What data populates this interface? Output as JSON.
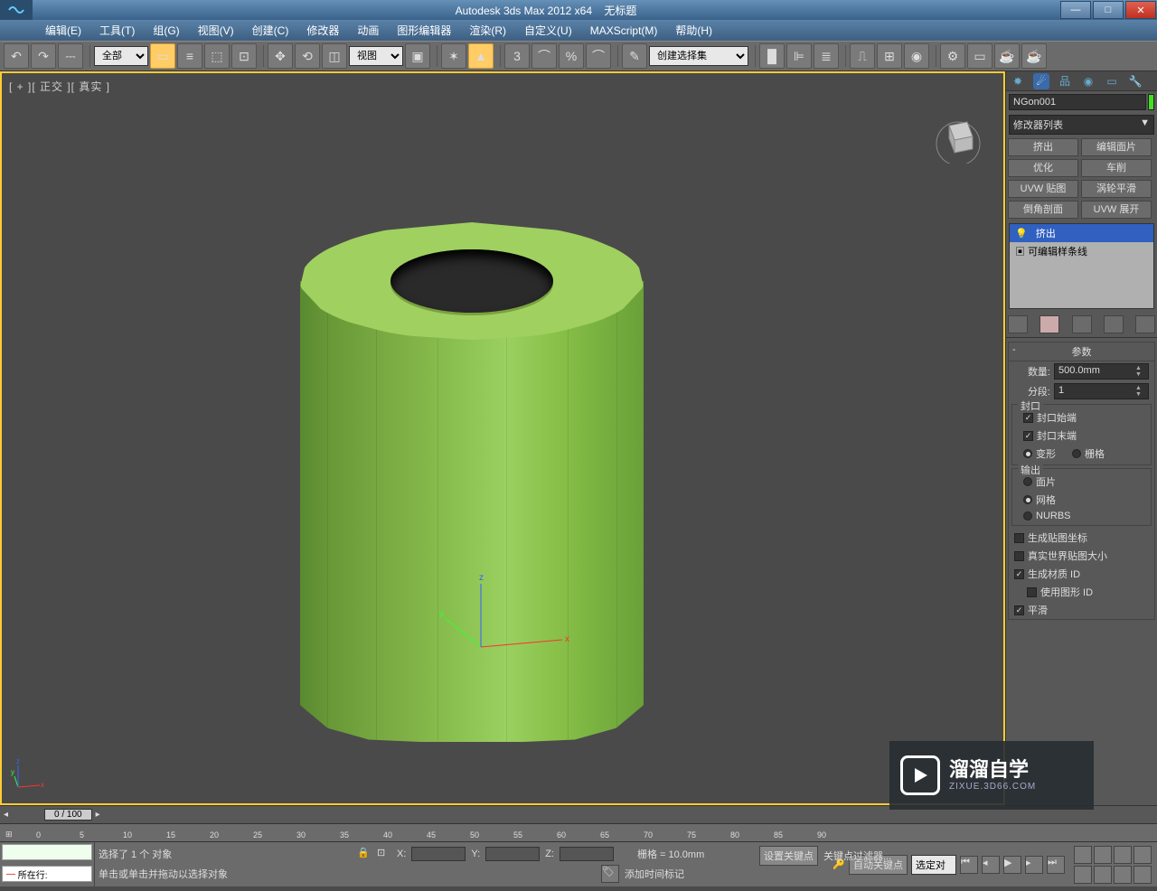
{
  "title": {
    "app": "Autodesk 3ds Max  2012 x64",
    "doc": "无标题"
  },
  "menus": [
    "编辑(E)",
    "工具(T)",
    "组(G)",
    "视图(V)",
    "创建(C)",
    "修改器",
    "动画",
    "图形编辑器",
    "渲染(R)",
    "自定义(U)",
    "MAXScript(M)",
    "帮助(H)"
  ],
  "toolbar": {
    "filter": "全部",
    "viewsel": "视图",
    "selset": "创建选择集"
  },
  "viewport": {
    "label": "[ + ][ 正交 ][ 真实 ]",
    "axes": {
      "x": "x",
      "y": "y",
      "z": "z"
    }
  },
  "object": {
    "name": "NGon001",
    "color": "#40e020"
  },
  "modifier_dd": "修改器列表",
  "modifier_buttons": [
    "挤出",
    "编辑面片",
    "优化",
    "车削",
    "UVW 贴图",
    "涡轮平滑",
    "倒角剖面",
    "UVW 展开"
  ],
  "stack": [
    {
      "label": "挤出",
      "selected": true,
      "icon": "💡"
    },
    {
      "label": "可编辑样条线",
      "selected": false,
      "icon": "▣"
    }
  ],
  "params": {
    "title": "参数",
    "amount_label": "数量:",
    "amount": "500.0mm",
    "segs_label": "分段:",
    "segs": "1",
    "cap_group": "封口",
    "cap_start": "封口始端",
    "cap_start_on": true,
    "cap_end": "封口末端",
    "cap_end_on": true,
    "morph": "变形",
    "morph_on": true,
    "grid": "栅格",
    "grid_on": false,
    "out_group": "输出",
    "patch": "面片",
    "patch_on": false,
    "mesh": "网格",
    "mesh_on": true,
    "nurbs": "NURBS",
    "nurbs_on": false,
    "gen_map": "生成贴图坐标",
    "gen_map_on": false,
    "real_world": "真实世界贴图大小",
    "real_world_on": false,
    "gen_mat": "生成材质 ID",
    "gen_mat_on": true,
    "use_shape": "使用图形 ID",
    "use_shape_on": false,
    "smooth": "平滑",
    "smooth_on": true
  },
  "timeline": {
    "frame": "0 / 100",
    "ticks": [
      0,
      5,
      10,
      15,
      20,
      25,
      30,
      35,
      40,
      45,
      50,
      55,
      60,
      65,
      70,
      75,
      80,
      85,
      90
    ]
  },
  "status": {
    "current_label": "所在行:",
    "sel": "选择了 1 个 对象",
    "hint": "单击或单击并拖动以选择对象",
    "x": "X:",
    "y": "Y:",
    "z": "Z:",
    "grid": "栅格 = 10.0mm",
    "autokey": "自动关键点",
    "selset": "选定对",
    "setkey": "设置关键点",
    "keyfilter": "关键点过滤器...",
    "addmarker": "添加时间标记"
  },
  "watermark": {
    "brand": "溜溜自学",
    "url": "ZIXUE.3D66.COM"
  }
}
